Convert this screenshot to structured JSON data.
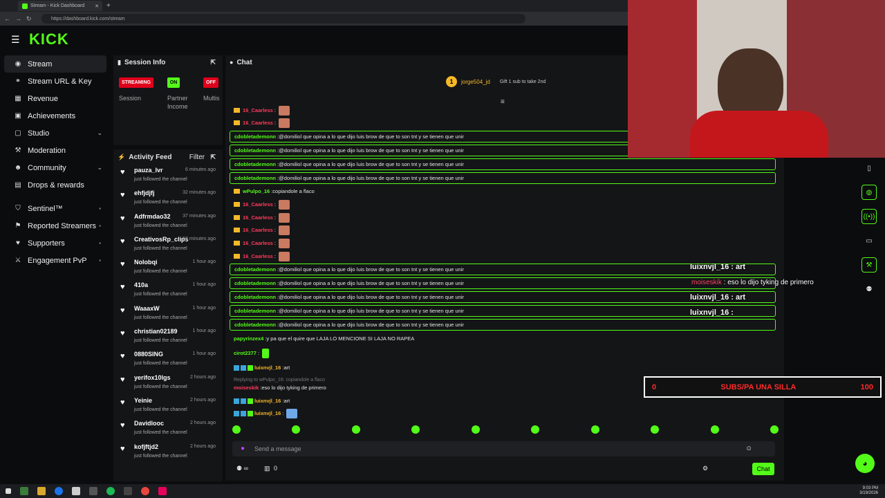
{
  "browser": {
    "tab_title": "Stream - Kick Dashboard",
    "url": "https://dashboard.kick.com/stream"
  },
  "brand": {
    "logo": "KICK",
    "accent": "#53fc18"
  },
  "sidebar": {
    "items": [
      {
        "label": "Stream",
        "icon": "stream-icon"
      },
      {
        "label": "Stream URL & Key",
        "icon": "link-icon"
      },
      {
        "label": "Revenue",
        "icon": "revenue-icon"
      },
      {
        "label": "Achievements",
        "icon": "trophy-icon"
      },
      {
        "label": "Studio",
        "icon": "studio-icon"
      },
      {
        "label": "Moderation",
        "icon": "wrench-icon"
      },
      {
        "label": "Community",
        "icon": "community-icon"
      },
      {
        "label": "Drops & rewards",
        "icon": "gift-icon"
      }
    ],
    "locked_items": [
      {
        "label": "Sentinel™"
      },
      {
        "label": "Reported Streamers"
      },
      {
        "label": "Supporters"
      },
      {
        "label": "Engagement PvP"
      }
    ]
  },
  "session": {
    "title": "Session Info",
    "pills": [
      "STREAMING",
      "ON",
      "OFF"
    ],
    "labels": [
      "Session",
      "Partner Income",
      "Multis"
    ]
  },
  "activity": {
    "title": "Activity Feed",
    "filter": "Filter",
    "followed_text": "just followed the channel",
    "items": [
      {
        "name": "pauza_lvr",
        "time": "6 minutes ago"
      },
      {
        "name": "ehfjdjfj",
        "time": "32 minutes ago"
      },
      {
        "name": "Adfrmdao32",
        "time": "37 minutes ago"
      },
      {
        "name": "CreativosRp_clips",
        "time": "58 minutes ago"
      },
      {
        "name": "Nolobqi",
        "time": "1 hour ago"
      },
      {
        "name": "410a",
        "time": "1 hour ago"
      },
      {
        "name": "WaaaxW",
        "time": "1 hour ago"
      },
      {
        "name": "christian02189",
        "time": "1 hour ago"
      },
      {
        "name": "0880SING",
        "time": "1 hour ago"
      },
      {
        "name": "yerifox10lgs",
        "time": "2 hours ago"
      },
      {
        "name": "Yeinie",
        "time": "2 hours ago"
      },
      {
        "name": "Davidlooc",
        "time": "2 hours ago"
      },
      {
        "name": "kofjftjd2",
        "time": "2 hours ago"
      }
    ]
  },
  "chat": {
    "title": "Chat",
    "pinned_user": "jorge504_jd",
    "pinned_rank": "1",
    "gift_text": "Gift 1 sub to take 2nd",
    "spam_text": "@domiliol que opina a lo que dijo luis brow de que to son tnt y se tienen que unir",
    "spam_user": "cdobletademonn",
    "user_16": "16_Caarless",
    "wpulpo_user": "wPulpo_16",
    "wpulpo_text": "copiandole a flaco",
    "papy_user": "papyrinzex4",
    "papy_text": "y pa que el quire que LAJA LO MENCIONE SI LAJA NO RAPEA",
    "ciro_user": "cirot2377",
    "luix_user": "luixnvjl_16",
    "luix_text": "art",
    "reply_text": "Replying to wPulpo_16: copiandole a flaco",
    "moises_user": "moiseskik",
    "moises_text": "eso lo dijo tyking de primero",
    "input_placeholder": "Send a message",
    "count": "0",
    "send": "Chat"
  },
  "overlay": {
    "line1": "luixnvjl_16 : art",
    "line2_user": "moiseskik",
    "line2_text": ": eso lo dijo tyking de primero",
    "line3": "luixnvjl_16 : art",
    "line4": "luixnvjl_16 :",
    "goal_start": "0",
    "goal_label": "SUBS/PA UNA SILLA",
    "goal_end": "100"
  },
  "taskbar": {
    "time": "9:03 PM",
    "date": "3/19/2026"
  }
}
